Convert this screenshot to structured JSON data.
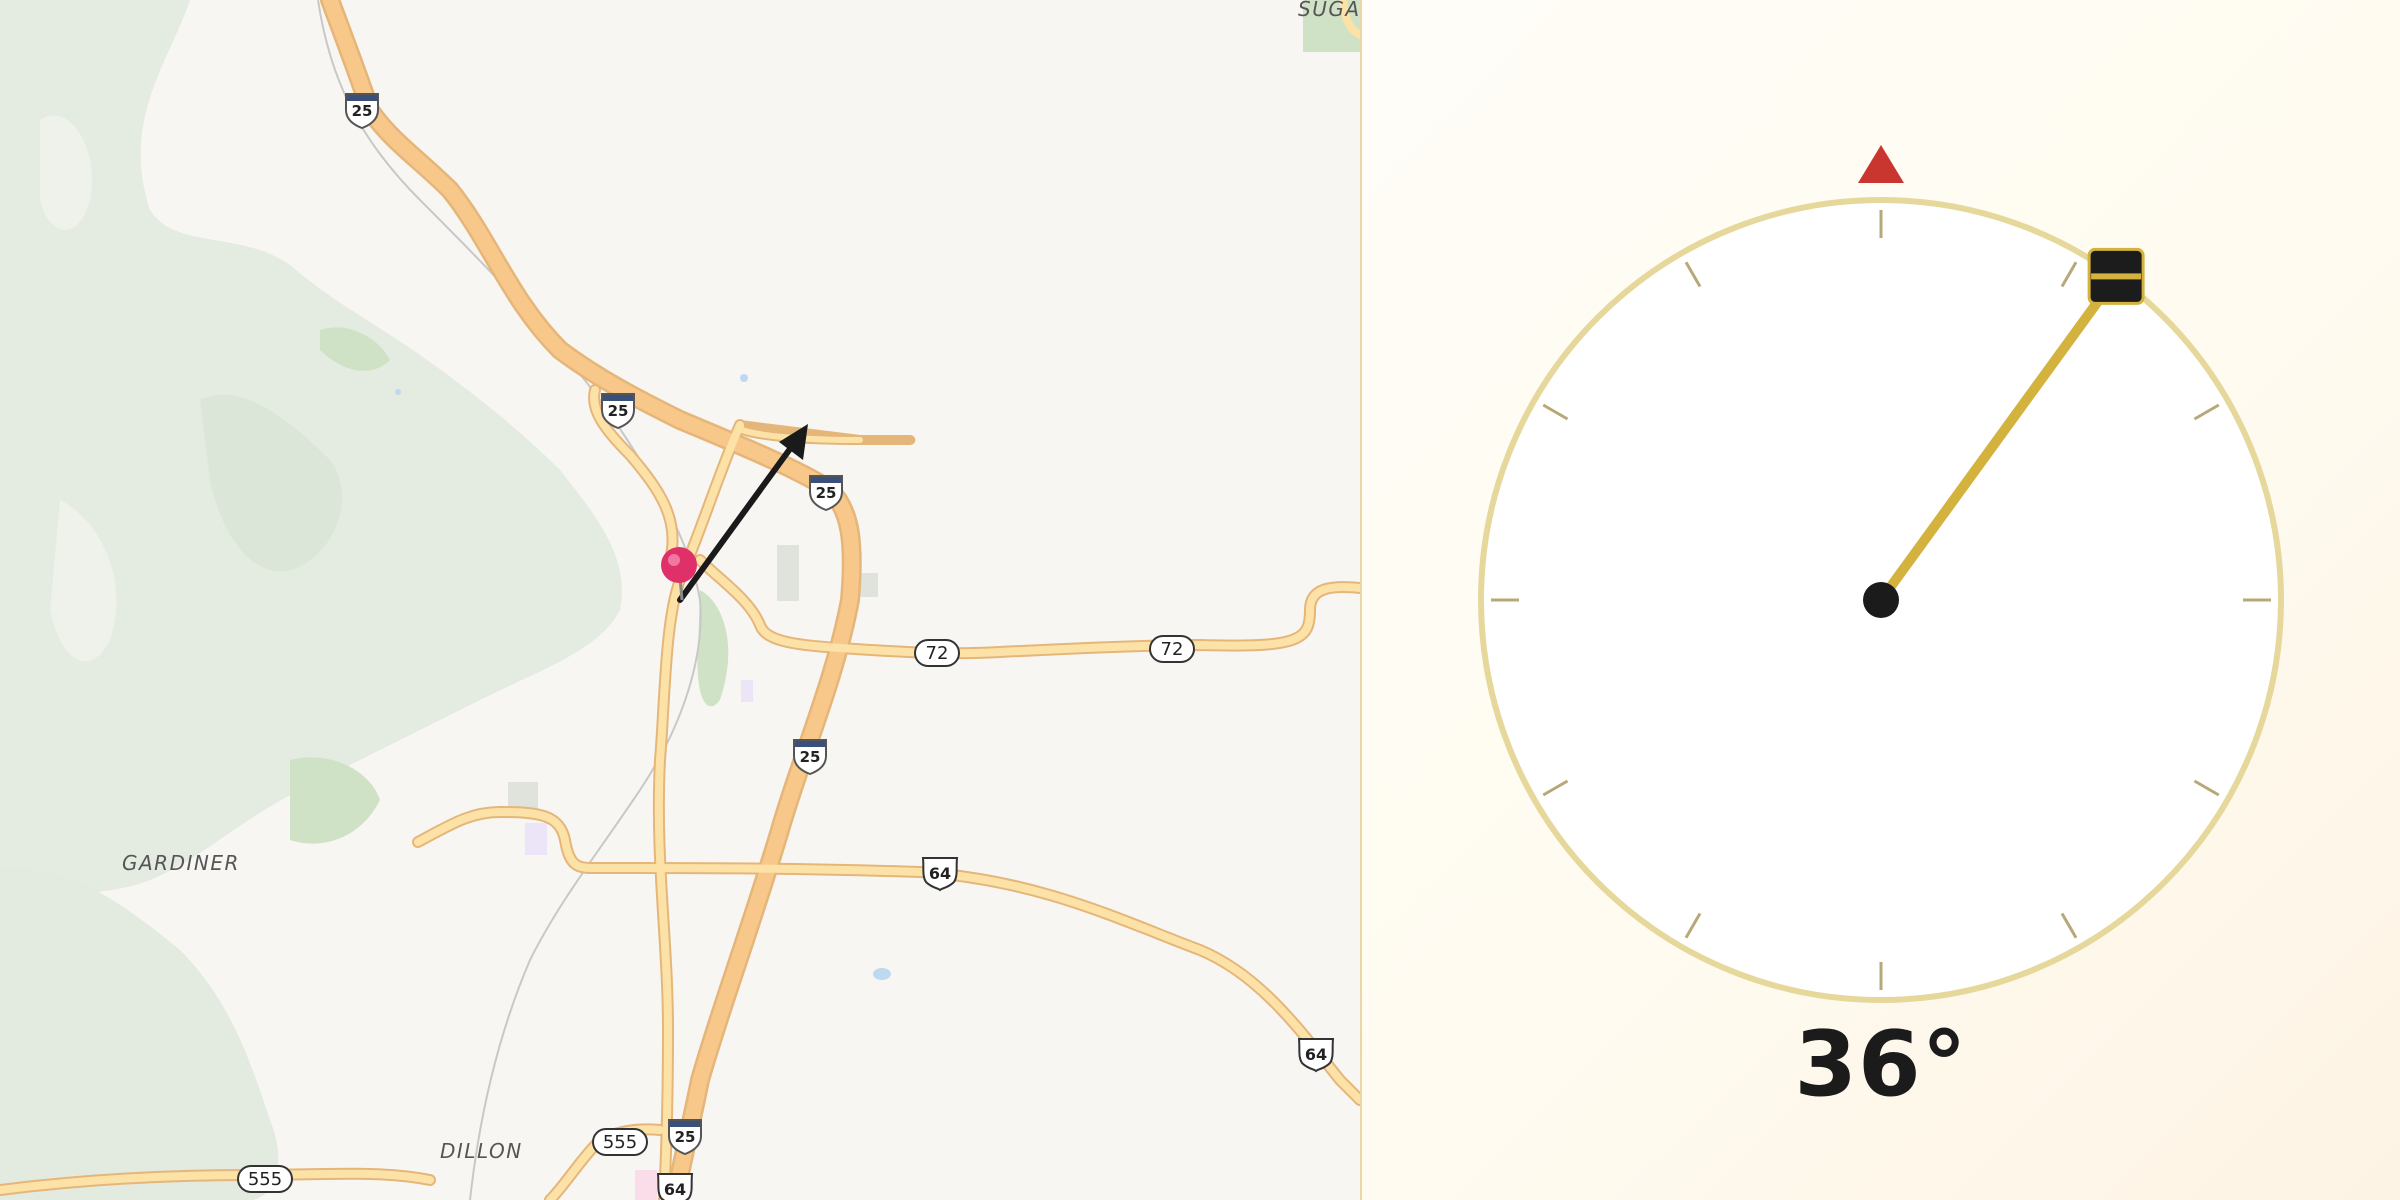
{
  "map": {
    "place_labels": [
      "SUGAR",
      "GARDINER",
      "DILLON"
    ],
    "shields": {
      "interstate": "25",
      "state_72": "72",
      "us_64": "64",
      "route_555": "555"
    }
  },
  "compass": {
    "heading_degrees": 36,
    "readout": "36°",
    "north_marker_color": "#c9362f",
    "needle_color": "#d4b23e",
    "ring_color": "#e6d79b",
    "tick_color": "#b7a878"
  },
  "colors": {
    "terrain_green": "#e3eae0",
    "park_green": "#cfe2c6",
    "highway_fill": "#f8c78a",
    "road_fill": "#fde2a8",
    "road_casing": "#e5b67a",
    "pin": "#e0306a"
  }
}
